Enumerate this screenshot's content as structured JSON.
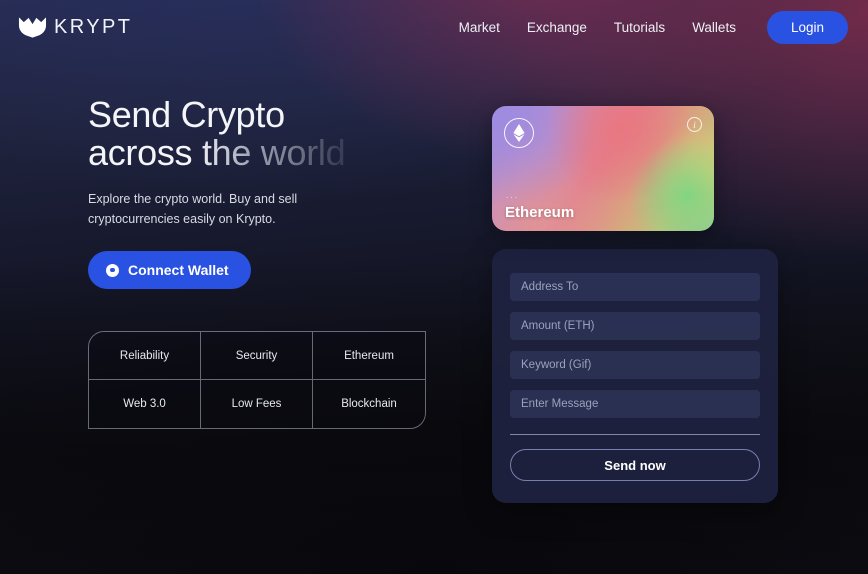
{
  "brand": {
    "name": "KRYPT",
    "logo_icon": "krypt-bat-logo-icon"
  },
  "nav": {
    "links": [
      {
        "label": "Market"
      },
      {
        "label": "Exchange"
      },
      {
        "label": "Tutorials"
      },
      {
        "label": "Wallets"
      }
    ],
    "login_label": "Login",
    "login_color": "#2952e3"
  },
  "hero": {
    "title_line1": "Send Crypto",
    "title_line2_plain": "across ",
    "title_line2_gradient": "the world",
    "subtitle": "Explore the crypto world. Buy and sell cryptocurrencies easily on Krypto.",
    "connect_label": "Connect Wallet",
    "connect_icon": "wallet-dot-icon",
    "connect_color": "#2952e3"
  },
  "features": [
    {
      "label": "Reliability"
    },
    {
      "label": "Security"
    },
    {
      "label": "Ethereum"
    },
    {
      "label": "Web 3.0"
    },
    {
      "label": "Low Fees"
    },
    {
      "label": "Blockchain"
    }
  ],
  "eth_card": {
    "logo_icon": "ethereum-diamond-icon",
    "info_icon": "info-circle-icon",
    "info_glyph": "i",
    "address": "...",
    "network": "Ethereum"
  },
  "send_form": {
    "fields": [
      {
        "name": "address-to",
        "placeholder": "Address To",
        "value": ""
      },
      {
        "name": "amount-eth",
        "placeholder": "Amount (ETH)",
        "value": ""
      },
      {
        "name": "keyword-gif",
        "placeholder": "Keyword (Gif)",
        "value": ""
      },
      {
        "name": "message",
        "placeholder": "Enter Message",
        "value": ""
      }
    ],
    "submit_label": "Send now"
  }
}
